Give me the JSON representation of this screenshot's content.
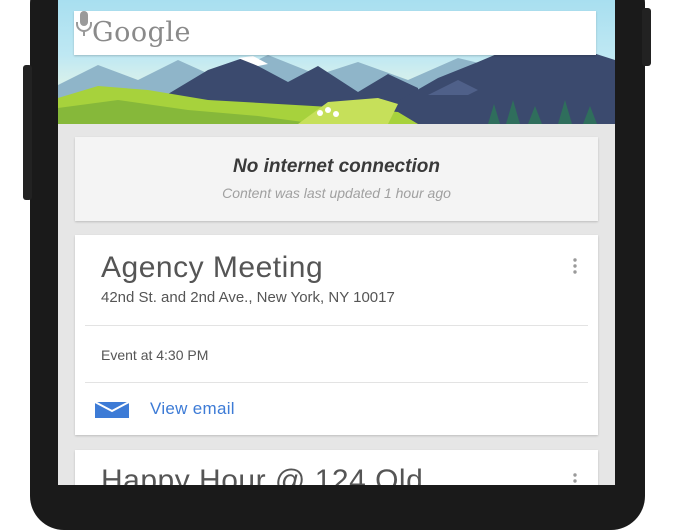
{
  "search": {
    "logo_text": "Google",
    "mic_icon": "microphone-icon"
  },
  "offline_card": {
    "title": "No internet connection",
    "subtitle": "Content was last updated 1 hour ago"
  },
  "meeting_card": {
    "title": "Agency Meeting",
    "address": "42nd St. and 2nd Ave., New York, NY 10017",
    "event_time": "Event at 4:30 PM",
    "action_label": "View email",
    "action_icon": "mail-icon",
    "menu_icon": "overflow-menu-icon"
  },
  "next_card": {
    "title": "Happy Hour @ 124 Old"
  },
  "colors": {
    "accent_blue": "#3d7bd6",
    "sky": "#a8dff0",
    "mountain_dark": "#3b4a6e",
    "grass": "#a7d23c"
  }
}
